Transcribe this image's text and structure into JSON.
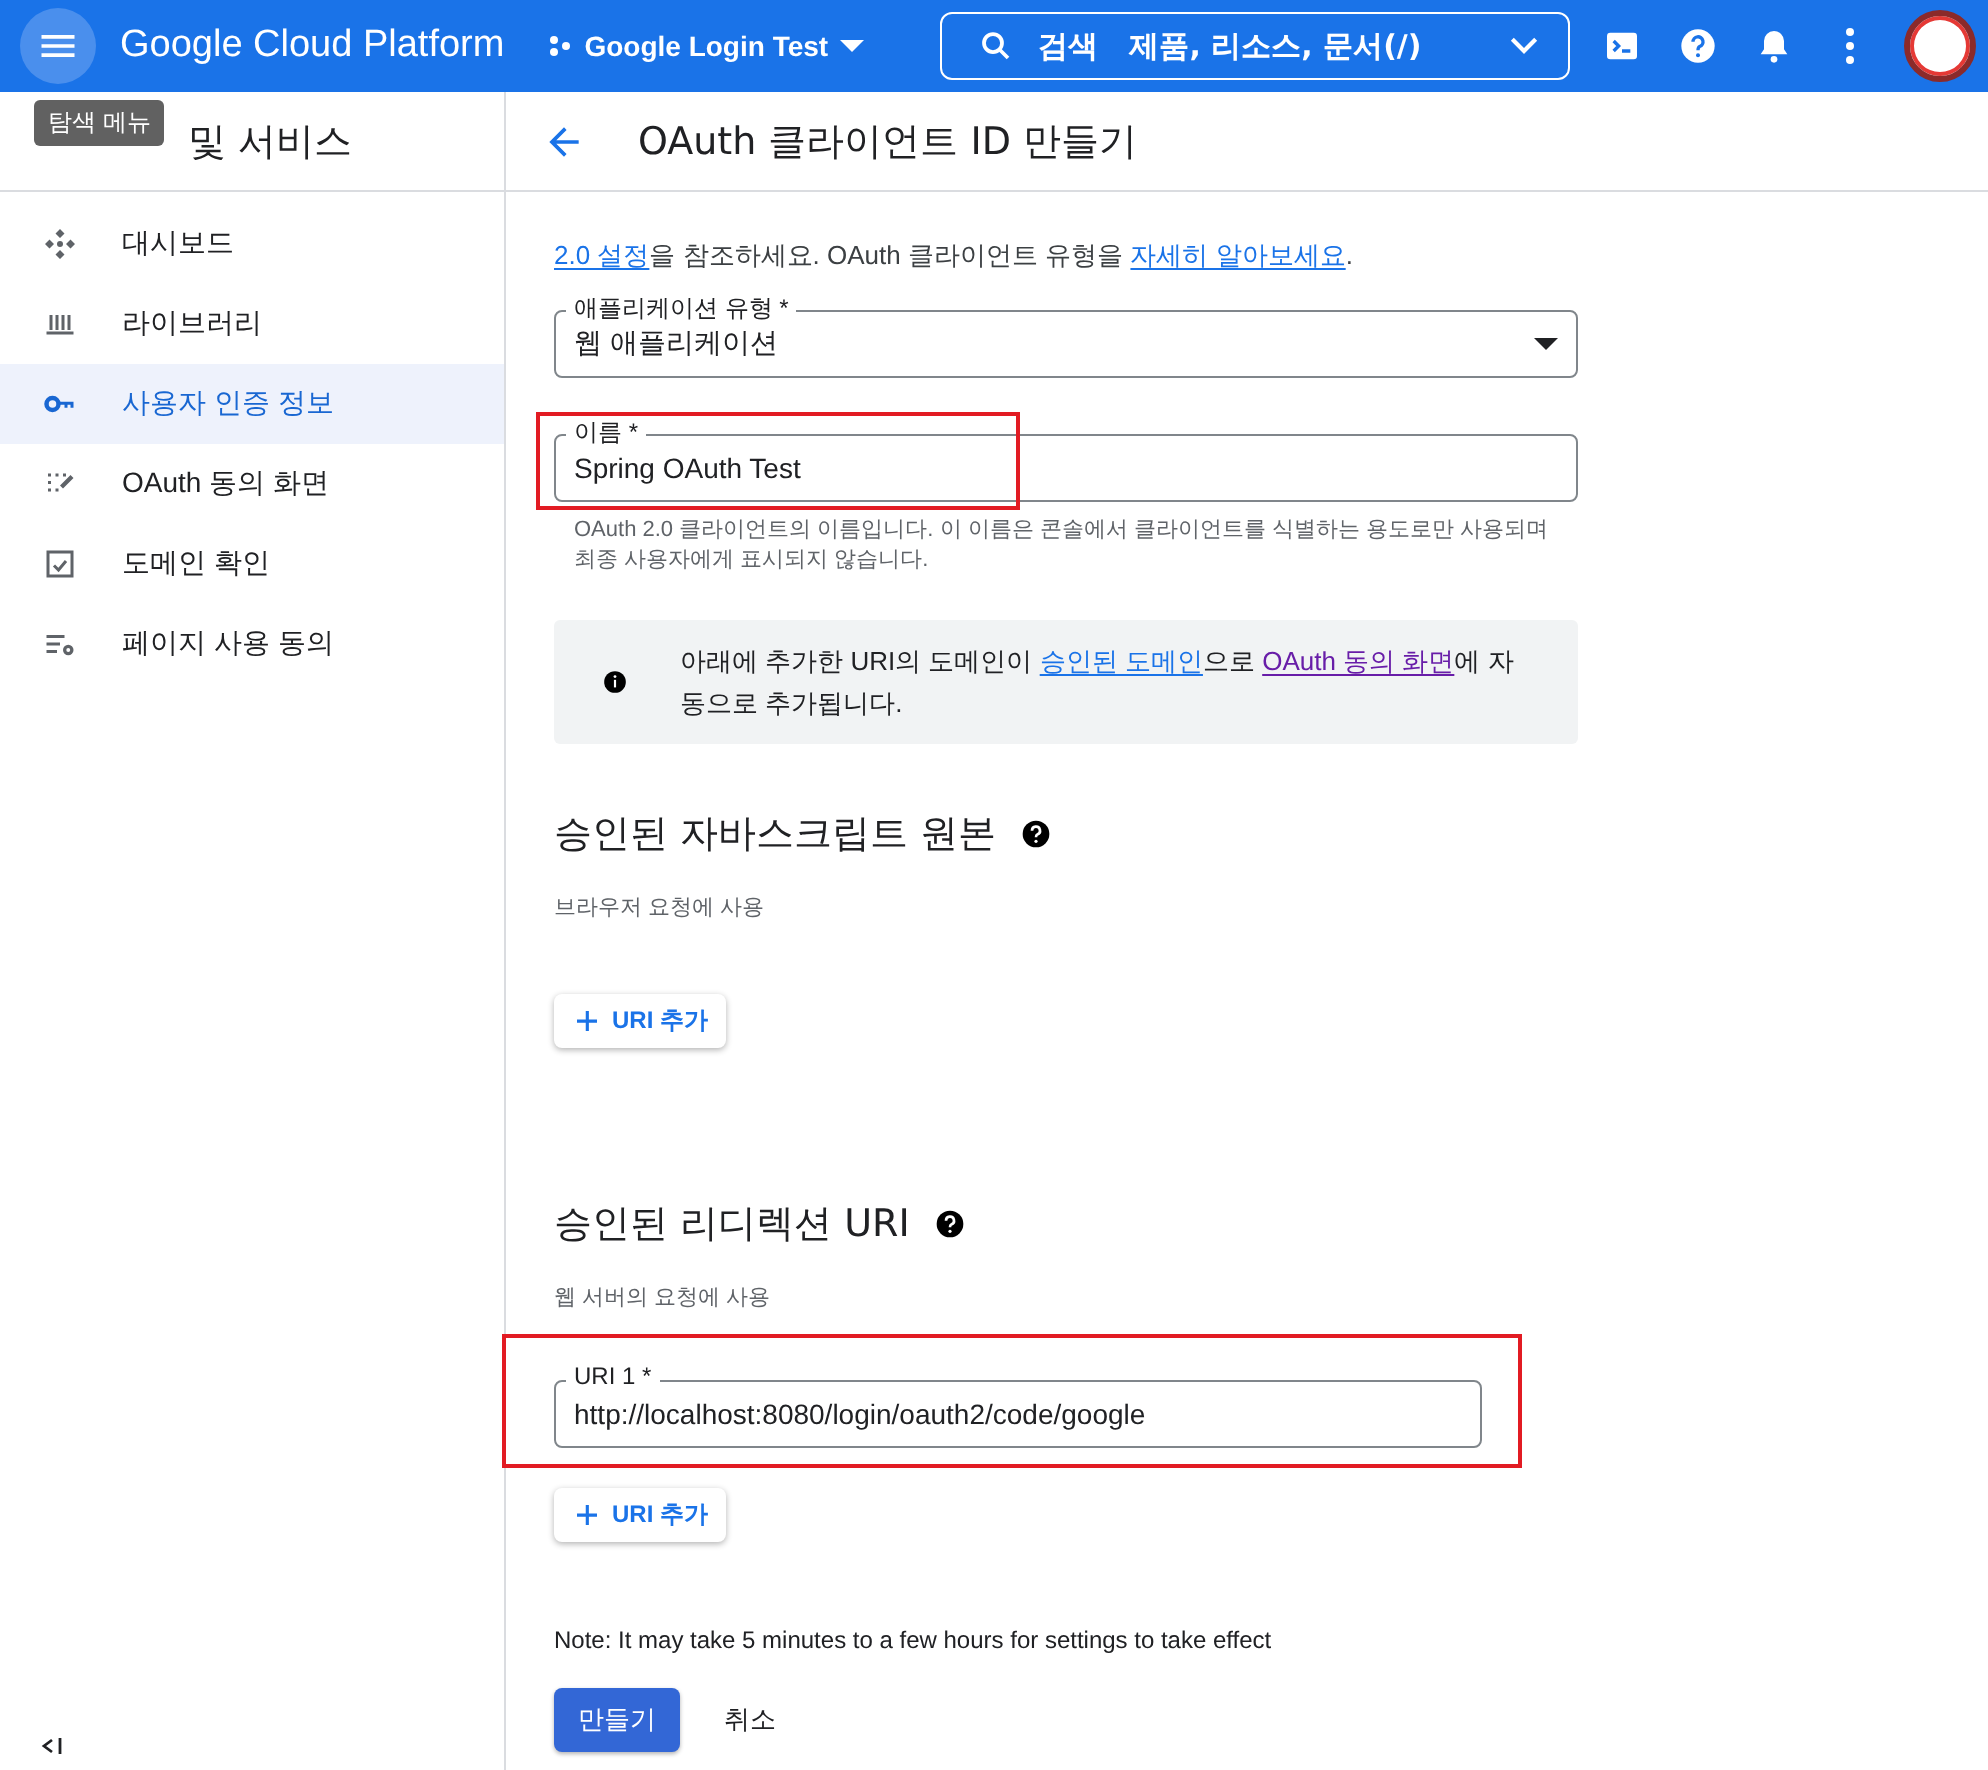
{
  "topbar": {
    "menu_tooltip": "탐색 메뉴",
    "product": "Google Cloud Platform",
    "project": "Google Login Test",
    "search": {
      "placeholder": "검색   제품, 리소스, 문서(/)"
    }
  },
  "sidebar": {
    "title": "및 서비스",
    "items": [
      {
        "label": "대시보드",
        "selected": false
      },
      {
        "label": "라이브러리",
        "selected": false
      },
      {
        "label": "사용자 인증 정보",
        "selected": true
      },
      {
        "label": "OAuth 동의 화면",
        "selected": false
      },
      {
        "label": "도메인 확인",
        "selected": false
      },
      {
        "label": "페이지 사용 동의",
        "selected": false
      }
    ]
  },
  "page": {
    "title": "OAuth 클라이언트 ID 만들기",
    "intro": [
      {
        "kind": "link",
        "text": "2.0 설정"
      },
      {
        "kind": "text",
        "text": "을 참조하세요. OAuth 클라이언트 유형을 "
      },
      {
        "kind": "link",
        "text": "자세히 알아보세요"
      },
      {
        "kind": "text",
        "text": "."
      }
    ],
    "app_type": {
      "label": "애플리케이션 유형 *",
      "value": "웹 애플리케이션"
    },
    "name": {
      "label": "이름 *",
      "value": "Spring OAuth Test",
      "highlighted": true,
      "helper": "OAuth 2.0 클라이언트의 이름입니다. 이 이름은 콘솔에서 클라이언트를 식별하는 용도로만 사용되며 최종 사용자에게 표시되지 않습니다."
    },
    "notice": [
      {
        "kind": "text",
        "text": "아래에 추가한 URI의 도메인이 "
      },
      {
        "kind": "link",
        "text": "승인된 도메인"
      },
      {
        "kind": "text",
        "text": "으로 "
      },
      {
        "kind": "visited",
        "text": "OAuth 동의 화면"
      },
      {
        "kind": "text",
        "text": "에 자동으로 추가됩니다."
      }
    ],
    "sections": [
      {
        "title": "승인된 자바스크립트 원본",
        "subtitle": "브라우저 요청에 사용",
        "add_button": "URI 추가"
      },
      {
        "title": "승인된 리디렉션 URI",
        "subtitle": "웹 서버의 요청에 사용",
        "uris": [
          {
            "label": "URI 1 *",
            "value": "http://localhost:8080/login/oauth2/code/google",
            "highlighted": true
          }
        ],
        "add_button": "URI 추가"
      }
    ],
    "note": "Note: It may take 5 minutes to a few hours for settings to take effect",
    "create_button": "만들기",
    "cancel_button": "취소"
  }
}
